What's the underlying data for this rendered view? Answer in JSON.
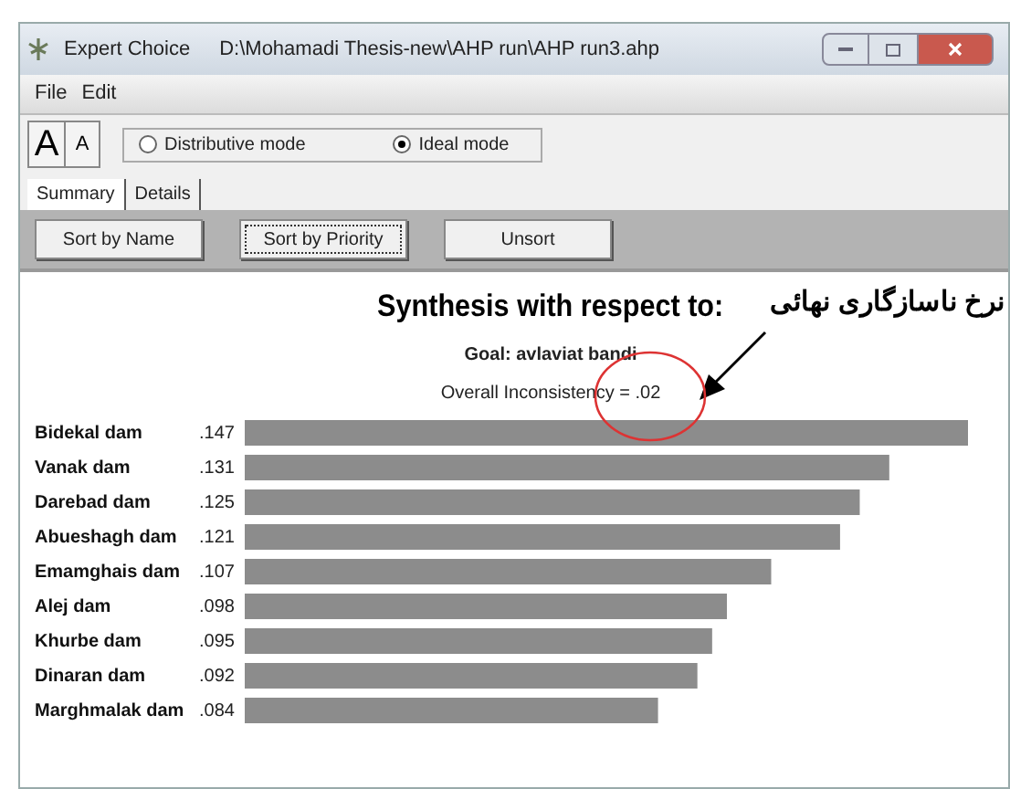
{
  "window": {
    "app": "Expert Choice",
    "path": "D:\\Mohamadi Thesis-new\\AHP run\\AHP run3.ahp"
  },
  "menu": [
    "File",
    "Edit"
  ],
  "font_buttons": [
    "A",
    "A"
  ],
  "modes": [
    {
      "label": "Distributive mode",
      "selected": false
    },
    {
      "label": "Ideal mode",
      "selected": true
    }
  ],
  "tabs": [
    {
      "label": "Summary",
      "selected": true
    },
    {
      "label": "Details",
      "selected": false
    }
  ],
  "sort_buttons": [
    {
      "label": "Sort by Name",
      "focused": false
    },
    {
      "label": "Sort by Priority",
      "focused": true
    },
    {
      "label": "Unsort",
      "focused": false
    }
  ],
  "heading": "Synthesis with respect to:",
  "goal": "Goal: avlaviat bandi",
  "inconsistency": "Overall Inconsistency = .02",
  "annotation": "نرخ ناسازگاری نهائی",
  "chart_data": {
    "type": "bar",
    "orientation": "horizontal",
    "data_labels": true,
    "categories": [
      "Bidekal dam",
      "Vanak dam",
      "Darebad dam",
      "Abueshagh dam",
      "Emamghais dam",
      "Alej dam",
      "Khurbe dam",
      "Dinaran dam",
      "Marghmalak dam"
    ],
    "values": [
      0.147,
      0.131,
      0.125,
      0.121,
      0.107,
      0.098,
      0.095,
      0.092,
      0.084
    ],
    "value_labels": [
      ".147",
      ".131",
      ".125",
      ".121",
      ".107",
      ".098",
      ".095",
      ".092",
      ".084"
    ]
  }
}
